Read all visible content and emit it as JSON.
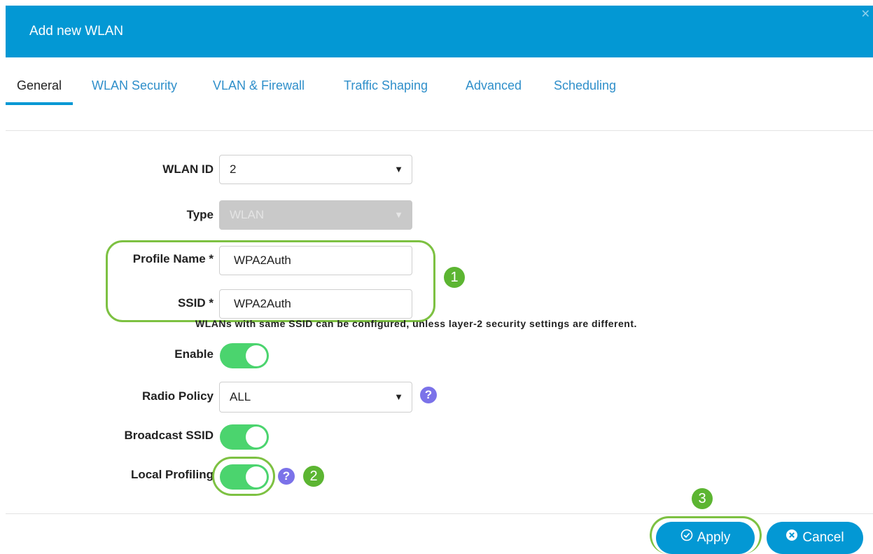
{
  "dialog": {
    "title": "Add new WLAN"
  },
  "tabs": [
    {
      "label": "General",
      "active": true
    },
    {
      "label": "WLAN Security"
    },
    {
      "label": "VLAN & Firewall"
    },
    {
      "label": "Traffic Shaping"
    },
    {
      "label": "Advanced"
    },
    {
      "label": "Scheduling"
    }
  ],
  "form": {
    "wlan_id": {
      "label": "WLAN ID",
      "value": "2"
    },
    "type": {
      "label": "Type",
      "value": "WLAN"
    },
    "profile_name": {
      "label": "Profile Name *",
      "value": "WPA2Auth"
    },
    "ssid": {
      "label": "SSID *",
      "value": "WPA2Auth"
    },
    "ssid_hint": "WLANs with same SSID can be configured, unless layer-2 security settings are different.",
    "enable": {
      "label": "Enable",
      "on": true
    },
    "radio_policy": {
      "label": "Radio Policy",
      "value": "ALL"
    },
    "broadcast_ssid": {
      "label": "Broadcast SSID",
      "on": true
    },
    "local_profiling": {
      "label": "Local Profiling",
      "on": true
    }
  },
  "annotations": {
    "step1": "1",
    "step2": "2",
    "step3": "3"
  },
  "buttons": {
    "apply": "Apply",
    "cancel": "Cancel"
  },
  "colors": {
    "header": "#0398d4",
    "toggle_on": "#4bd46e",
    "highlight": "#7dc142",
    "help": "#7b72e9"
  }
}
